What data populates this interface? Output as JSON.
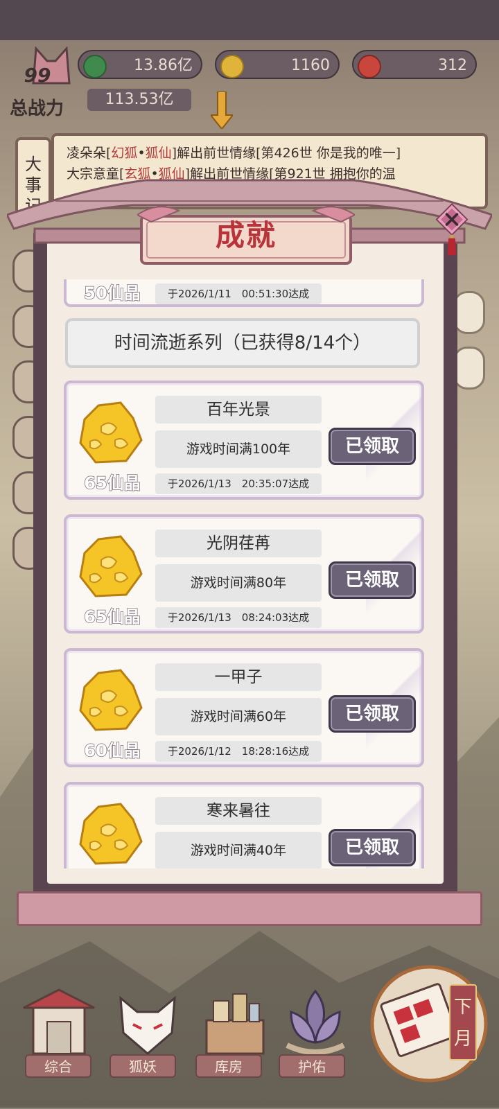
{
  "hud": {
    "resources": [
      {
        "name": "jade",
        "value": "13.86亿",
        "color": "#3f8a4c"
      },
      {
        "name": "gold",
        "value": "1160",
        "color": "#e0b43a"
      },
      {
        "name": "fruit",
        "value": "312",
        "color": "#c8463c"
      }
    ],
    "level": "99",
    "power_label": "总战力",
    "power_value": "113.53亿"
  },
  "news": {
    "tab_label": "大事记",
    "lines": [
      {
        "pre": "凌朵朵[",
        "a": "幻狐",
        "mid": "•",
        "b": "狐仙",
        "post": "]解出前世情缘[第426世 你是我的唯一]"
      },
      {
        "pre": "大宗意童[",
        "a": "玄狐",
        "mid": "•",
        "b": "狐仙",
        "post": "]解出前世情缘[第921世 拥抱你的温"
      }
    ]
  },
  "modal": {
    "title": "成就",
    "partial_card": {
      "reward": "50仙晶",
      "date": "于2026/1/11　00:51:30达成"
    },
    "series_header": "时间流逝系列（已获得8/14个）",
    "achievements": [
      {
        "title": "百年光景",
        "desc": "游戏时间满100年",
        "reward": "65仙晶",
        "date": "于2026/1/13　20:35:07达成",
        "button": "已领取"
      },
      {
        "title": "光阴荏苒",
        "desc": "游戏时间满80年",
        "reward": "65仙晶",
        "date": "于2026/1/13　08:24:03达成",
        "button": "已领取"
      },
      {
        "title": "一甲子",
        "desc": "游戏时间满60年",
        "reward": "60仙晶",
        "date": "于2026/1/12　18:28:16达成",
        "button": "已领取"
      },
      {
        "title": "寒来暑往",
        "desc": "游戏时间满40年",
        "reward": "",
        "date": "",
        "button": "已领取"
      }
    ]
  },
  "nav": {
    "items": [
      {
        "label": "综合",
        "icon": "gate-icon"
      },
      {
        "label": "狐妖",
        "icon": "fox-mask-icon"
      },
      {
        "label": "库房",
        "icon": "storehouse-icon"
      },
      {
        "label": "护佑",
        "icon": "lotus-icon"
      }
    ],
    "month_button": "下月"
  }
}
